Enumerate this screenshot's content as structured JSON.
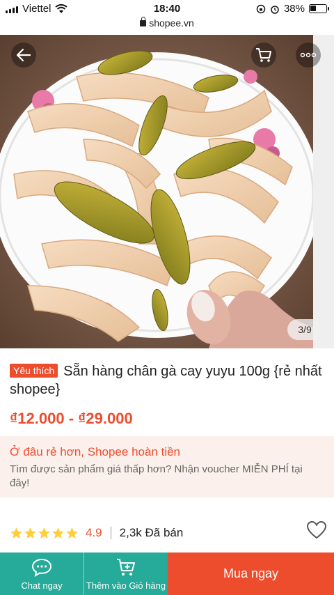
{
  "status_bar": {
    "carrier": "Viettel",
    "time": "18:40",
    "url": "shopee.vn",
    "battery": "38%",
    "battery_level": 0.38
  },
  "gallery": {
    "indicator": "3/9"
  },
  "product": {
    "badge": "Yêu thích",
    "title": "Sẵn hàng chân gà cay yuyu 100g {rẻ nhất shopee}",
    "price": "₫12.000 - ₫29.000"
  },
  "cashback": {
    "title": "Ở đâu rẻ hơn, Shopee hoàn tiền",
    "description": "Tìm được sản phẩm giá thấp hơn? Nhận voucher MIỄN PHÍ tại đây!"
  },
  "rating": {
    "stars": 5,
    "value": "4.9",
    "sold": "2,3k Đã bán"
  },
  "bottom_bar": {
    "chat_label": "Chat ngay",
    "cart_label": "Thêm vào Giỏ hàng",
    "buy_label": "Mua ngay"
  },
  "colors": {
    "accent": "#ee4d2d",
    "teal": "#26aa99",
    "star": "#ffce3d"
  }
}
